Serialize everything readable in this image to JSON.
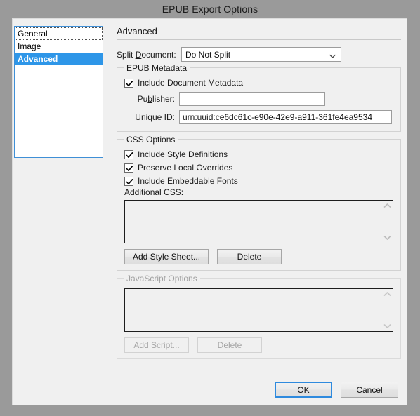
{
  "window": {
    "title": "EPUB Export Options"
  },
  "sidebar": {
    "items": [
      {
        "label": "General",
        "state": "focused"
      },
      {
        "label": "Image",
        "state": "normal"
      },
      {
        "label": "Advanced",
        "state": "selected"
      }
    ]
  },
  "pane": {
    "heading": "Advanced",
    "split_document": {
      "label_pre": "Split ",
      "label_accel": "D",
      "label_post": "ocument:",
      "value": "Do Not Split",
      "options": [
        "Do Not Split"
      ]
    },
    "epub_metadata": {
      "title": "EPUB Metadata",
      "include_document_metadata": {
        "label": "Include Document Metadata",
        "checked": true
      },
      "publisher": {
        "label_pre": "Pu",
        "label_accel": "b",
        "label_post": "lisher:",
        "value": "",
        "placeholder": ""
      },
      "unique_id": {
        "label_accel": "U",
        "label_post": "nique ID:",
        "value": "urn:uuid:ce6dc61c-e90e-42e9-a911-361fe4ea9534",
        "placeholder": ""
      }
    },
    "css_options": {
      "title": "CSS Options",
      "checkboxes": [
        {
          "label": "Include Style Definitions",
          "checked": true
        },
        {
          "label": "Preserve Local Overrides",
          "checked": true
        },
        {
          "label": "Include Embeddable Fonts",
          "checked": true
        }
      ],
      "additional_css_label": "Additional CSS:",
      "list_items": [],
      "add_button": "Add Style Sheet...",
      "delete_button": "Delete"
    },
    "javascript_options": {
      "title": "JavaScript Options",
      "disabled": true,
      "list_items": [],
      "add_button": "Add Script...",
      "delete_button": "Delete"
    }
  },
  "footer": {
    "ok": "OK",
    "cancel": "Cancel"
  },
  "colors": {
    "window_backdrop": "#9a9a9a",
    "dialog_background": "#f0f0f0",
    "selection_blue": "#2e96e8",
    "focus_blue": "#2e8ade",
    "text": "#1a1a1a",
    "disabled_text": "#a0a0a0",
    "field_background": "#ffffff",
    "field_border": "#9c9c9c",
    "group_border": "#d2d2d2"
  },
  "icons": {
    "chevron_down": "chevron-down-icon",
    "scroll_up": "scroll-up-arrow-icon",
    "scroll_down": "scroll-down-arrow-icon",
    "checkmark": "checkmark-icon"
  }
}
